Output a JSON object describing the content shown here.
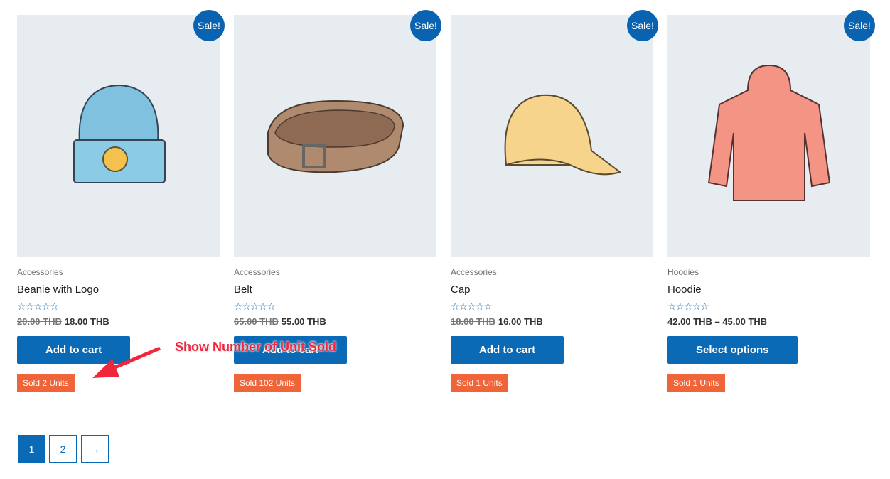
{
  "products": [
    {
      "category": "Accessories",
      "title": "Beanie with Logo",
      "old_price": "20.00 THB",
      "price": "18.00 THB",
      "button": "Add to cart",
      "sold": "Sold 2 Units",
      "sale": "Sale!",
      "stars": "☆☆☆☆☆"
    },
    {
      "category": "Accessories",
      "title": "Belt",
      "old_price": "65.00 THB",
      "price": "55.00 THB",
      "button": "Add to cart",
      "sold": "Sold 102 Units",
      "sale": "Sale!",
      "stars": "☆☆☆☆☆"
    },
    {
      "category": "Accessories",
      "title": "Cap",
      "old_price": "18.00 THB",
      "price": "16.00 THB",
      "button": "Add to cart",
      "sold": "Sold 1 Units",
      "sale": "Sale!",
      "stars": "☆☆☆☆☆"
    },
    {
      "category": "Hoodies",
      "title": "Hoodie",
      "old_price": "",
      "price": "42.00 THB – 45.00 THB",
      "button": "Select options",
      "sold": "Sold 1 Units",
      "sale": "Sale!",
      "stars": "☆☆☆☆☆"
    }
  ],
  "pagination": {
    "current": "1",
    "page2": "2",
    "next": "→"
  },
  "annotation": "Show Number of Unit Sold",
  "colors": {
    "accent": "#0a6ab5",
    "sold": "#f0643a",
    "annotation": "#f0263d"
  }
}
